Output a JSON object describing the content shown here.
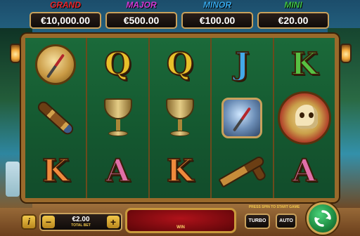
{
  "jackpots": [
    {
      "label": "GRAND",
      "value": "€10,000.00",
      "color": "#e8252b"
    },
    {
      "label": "MAJOR",
      "value": "€500.00",
      "color": "#d23ad6"
    },
    {
      "label": "MINOR",
      "value": "€100.00",
      "color": "#35a6e8"
    },
    {
      "label": "MINI",
      "value": "€20.00",
      "color": "#3fc146"
    }
  ],
  "reels": [
    [
      "compass-icon",
      "spyglass-icon",
      "K"
    ],
    [
      "Q",
      "chalice-icon",
      "A"
    ],
    [
      "Q",
      "chalice-icon",
      "K"
    ],
    [
      "J",
      "compass-icon",
      "pistol-icon"
    ],
    [
      "K",
      "skull-medallion-icon",
      "A"
    ]
  ],
  "controls": {
    "info_label": "i",
    "bet_minus": "−",
    "bet_plus": "+",
    "bet_value": "€2.00",
    "bet_label": "TOTAL BET",
    "win_label": "WIN",
    "hint": "PRESS SPIN TO START GAME",
    "turbo_label": "TURBO",
    "auto_label": "AUTO"
  }
}
